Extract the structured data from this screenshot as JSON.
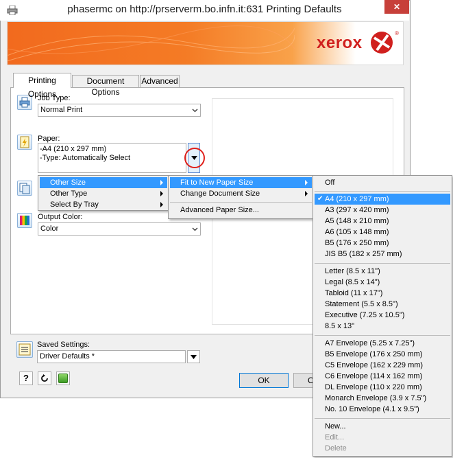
{
  "window": {
    "title": "phasermc on http://prserverm.bo.infn.it:631 Printing Defaults",
    "close_glyph": "✕"
  },
  "banner": {
    "brand": "xerox",
    "registered": "®",
    "accent": "#f26a1e",
    "logo_color": "#d0201e"
  },
  "tabs": [
    {
      "label": "Printing Options",
      "active": true
    },
    {
      "label": "Document Options",
      "active": false
    },
    {
      "label": "Advanced",
      "active": false
    }
  ],
  "job_type": {
    "label": "Job Type:",
    "value": "Normal Print",
    "icon": "printer-icon"
  },
  "paper": {
    "label": "Paper:",
    "lines": [
      "-A4 (210 x 297 mm)",
      "-Type: Automatically Select"
    ],
    "icon": "paper-icon"
  },
  "output_color": {
    "label": "Output Color:",
    "value": "Color",
    "icon": "color-icon"
  },
  "paper_menu": {
    "items": [
      {
        "label": "Other Size",
        "highlighted": true,
        "submenu": true
      },
      {
        "label": "Other Type",
        "highlighted": false,
        "submenu": true
      },
      {
        "label": "Select By Tray",
        "highlighted": false,
        "submenu": true
      }
    ]
  },
  "size_menu": {
    "items": [
      {
        "label": "Fit to New Paper Size",
        "highlighted": true,
        "submenu": true
      },
      {
        "label": "Change Document Size",
        "highlighted": false,
        "submenu": true
      }
    ],
    "advanced_label": "Advanced Paper Size..."
  },
  "fit_menu": {
    "off_label": "Off",
    "iso_sizes": [
      {
        "label": "A4 (210 x 297 mm)",
        "checked": true
      },
      {
        "label": "A3 (297 x 420 mm)"
      },
      {
        "label": "A5 (148 x 210 mm)"
      },
      {
        "label": "A6 (105 x 148 mm)"
      },
      {
        "label": "B5 (176 x 250 mm)"
      },
      {
        "label": "JIS B5 (182 x 257 mm)"
      }
    ],
    "us_sizes": [
      "Letter (8.5 x 11\")",
      "Legal (8.5 x 14\")",
      "Tabloid (11 x 17\")",
      "Statement (5.5 x 8.5\")",
      "Executive (7.25 x 10.5\")",
      "8.5 x 13\""
    ],
    "envelopes": [
      "A7 Envelope (5.25 x 7.25\")",
      "B5 Envelope (176 x 250 mm)",
      "C5 Envelope (162 x 229 mm)",
      "C6 Envelope (114 x 162 mm)",
      "DL Envelope (110 x 220 mm)",
      "Monarch Envelope (3.9 x 7.5\")",
      "No. 10 Envelope (4.1 x 9.5\")"
    ],
    "actions": [
      {
        "label": "New...",
        "enabled": true
      },
      {
        "label": "Edit...",
        "enabled": false
      },
      {
        "label": "Delete",
        "enabled": false
      }
    ],
    "check_glyph": "✔",
    "highlight_color": "#3399ff"
  },
  "saved_settings": {
    "label": "Saved Settings:",
    "value": "Driver Defaults *"
  },
  "bottom": {
    "help_glyph": "?",
    "ok_label": "OK",
    "cancel_partial": "C"
  }
}
